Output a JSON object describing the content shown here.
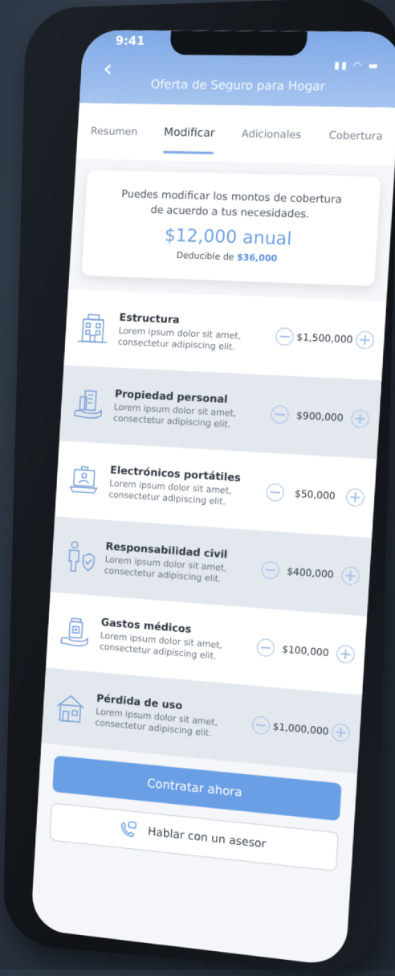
{
  "status": {
    "time": "9:41",
    "indicators": "▮▮ ◠ ▬"
  },
  "header": {
    "back": "‹",
    "title": "Oferta de Seguro para Hogar"
  },
  "tabs": [
    {
      "label": "Resumen"
    },
    {
      "label": "Modificar"
    },
    {
      "label": "Adicionales"
    },
    {
      "label": "Cobertura"
    }
  ],
  "card": {
    "line1": "Puedes modificar los montos de cobertura",
    "line2": "de acuerdo a tus necesidades.",
    "price": "$12,000 anual",
    "deductible_label": "Deducible de",
    "deductible_value": "$36,000"
  },
  "items": [
    {
      "title": "Estructura",
      "desc1": "Lorem ipsum dolor sit amet,",
      "desc2": "consectetur adipiscing elit.",
      "amount": "$1,500,000"
    },
    {
      "title": "Propiedad personal",
      "desc1": "Lorem ipsum dolor sit amet,",
      "desc2": "consectetur adipiscing elit.",
      "amount": "$900,000"
    },
    {
      "title": "Electrónicos portátiles",
      "desc1": "Lorem ipsum dolor sit amet,",
      "desc2": "consectetur adipiscing elit.",
      "amount": "$50,000"
    },
    {
      "title": "Responsabilidad civil",
      "desc1": "Lorem ipsum dolor sit amet,",
      "desc2": "consectetur adipiscing elit.",
      "amount": "$400,000"
    },
    {
      "title": "Gastos médicos",
      "desc1": "Lorem ipsum dolor sit amet,",
      "desc2": "consectetur adipiscing elit.",
      "amount": "$100,000"
    },
    {
      "title": "Pérdida de uso",
      "desc1": "Lorem ipsum dolor sit amet,",
      "desc2": "consectetur adipiscing elit.",
      "amount": "$1,000,000"
    }
  ],
  "buttons": {
    "primary": "Contratar ahora",
    "secondary": "Hablar con un asesor"
  },
  "colors": {
    "accent": "#6a9fe6",
    "header": "#7fa9e6",
    "icon": "#7fa3d8"
  }
}
